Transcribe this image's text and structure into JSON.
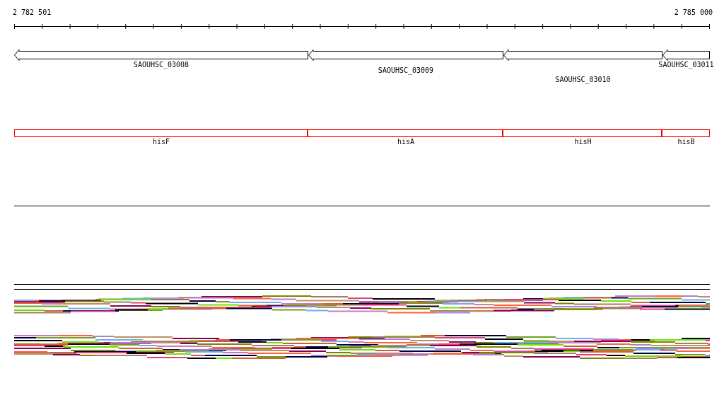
{
  "ruler": {
    "start_label": "2 782 501",
    "end_label": "2 785 000"
  },
  "genes": [
    {
      "label": "SAOUHSC_03008"
    },
    {
      "label": "SAOUHSC_03009"
    },
    {
      "label": "SAOUHSC_03010"
    },
    {
      "label": "SAOUHSC_03011"
    }
  ],
  "features": [
    {
      "label": "hisF"
    },
    {
      "label": "hisA"
    },
    {
      "label": "hisH"
    },
    {
      "label": "hisB"
    }
  ]
}
